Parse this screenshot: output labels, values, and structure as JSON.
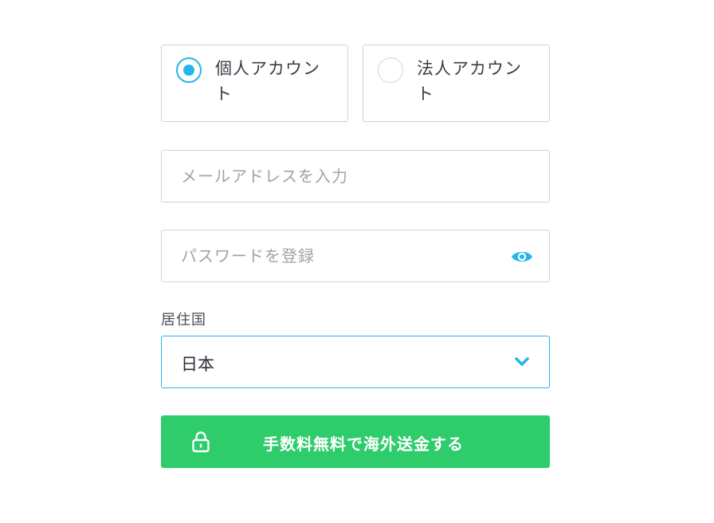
{
  "account_types": [
    {
      "label": "個人アカウント",
      "selected": true
    },
    {
      "label": "法人アカウント",
      "selected": false
    }
  ],
  "email": {
    "placeholder": "メールアドレスを入力",
    "value": ""
  },
  "password": {
    "placeholder": "パスワードを登録",
    "value": "",
    "toggle_icon": "eye-icon"
  },
  "country": {
    "label": "居住国",
    "selected": "日本",
    "icon": "chevron-down-icon"
  },
  "submit": {
    "label": "手数料無料で海外送金する",
    "icon": "lock-icon"
  },
  "colors": {
    "accent": "#26b5ea",
    "button": "#2ecc6b",
    "border": "#cfd3d9",
    "placeholder": "#9ea3ab"
  }
}
